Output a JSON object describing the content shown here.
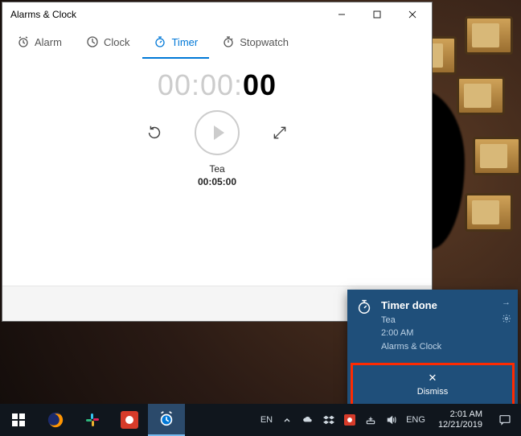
{
  "window": {
    "title": "Alarms & Clock",
    "tabs": [
      {
        "label": "Alarm"
      },
      {
        "label": "Clock"
      },
      {
        "label": "Timer"
      },
      {
        "label": "Stopwatch"
      }
    ],
    "active_tab": 2
  },
  "timer": {
    "display_faded": "00:00:",
    "display_bold": "00",
    "label": "Tea",
    "duration": "00:05:00"
  },
  "toast": {
    "title": "Timer done",
    "subtitle": "Tea",
    "time": "2:00 AM",
    "app": "Alarms & Clock",
    "dismiss": "Dismiss"
  },
  "tray": {
    "input_lang": "EN",
    "kb_lang": "ENG",
    "time": "2:01 AM",
    "date": "12/21/2019"
  }
}
